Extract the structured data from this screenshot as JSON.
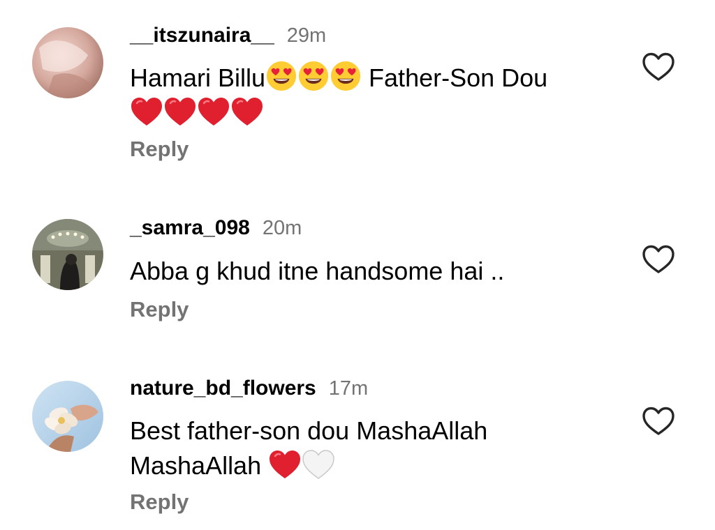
{
  "comments": [
    {
      "username": "__itszunaira__",
      "time": "29m",
      "text_line1": "Hamari Billu",
      "text_after_emoji": " Father-Son Dou",
      "emoji_line1": [
        "heart-eyes",
        "heart-eyes",
        "heart-eyes"
      ],
      "emoji_line2": [
        "red-heart",
        "red-heart",
        "red-heart",
        "red-heart"
      ],
      "reply_label": "Reply"
    },
    {
      "username": "_samra_098",
      "time": "20m",
      "text_line1": "Abba g khud itne handsome hai ..",
      "reply_label": "Reply"
    },
    {
      "username": "nature_bd_flowers",
      "time": "17m",
      "text_line1": "Best father-son dou MashaAllah",
      "text_line2": "MashaAllah ",
      "emoji_line2": [
        "red-heart",
        "white-heart"
      ],
      "reply_label": "Reply"
    }
  ],
  "icons": {
    "like": "heart-outline-icon"
  },
  "colors": {
    "username": "#000000",
    "secondary": "#737373",
    "like_stroke": "#262626",
    "red_heart": "#E0202E",
    "white_heart": "#F4F4F4"
  }
}
